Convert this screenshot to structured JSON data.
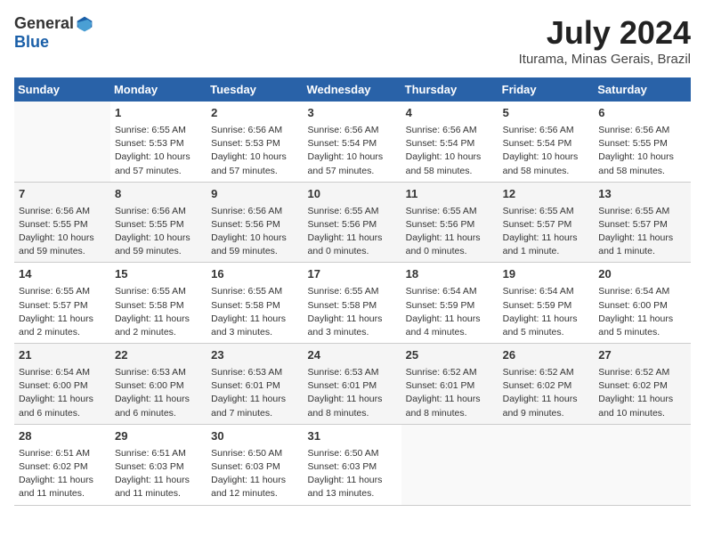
{
  "header": {
    "logo_general": "General",
    "logo_blue": "Blue",
    "month_title": "July 2024",
    "subtitle": "Iturama, Minas Gerais, Brazil"
  },
  "days_of_week": [
    "Sunday",
    "Monday",
    "Tuesday",
    "Wednesday",
    "Thursday",
    "Friday",
    "Saturday"
  ],
  "weeks": [
    [
      {
        "day": "",
        "info": ""
      },
      {
        "day": "1",
        "info": "Sunrise: 6:55 AM\nSunset: 5:53 PM\nDaylight: 10 hours\nand 57 minutes."
      },
      {
        "day": "2",
        "info": "Sunrise: 6:56 AM\nSunset: 5:53 PM\nDaylight: 10 hours\nand 57 minutes."
      },
      {
        "day": "3",
        "info": "Sunrise: 6:56 AM\nSunset: 5:54 PM\nDaylight: 10 hours\nand 57 minutes."
      },
      {
        "day": "4",
        "info": "Sunrise: 6:56 AM\nSunset: 5:54 PM\nDaylight: 10 hours\nand 58 minutes."
      },
      {
        "day": "5",
        "info": "Sunrise: 6:56 AM\nSunset: 5:54 PM\nDaylight: 10 hours\nand 58 minutes."
      },
      {
        "day": "6",
        "info": "Sunrise: 6:56 AM\nSunset: 5:55 PM\nDaylight: 10 hours\nand 58 minutes."
      }
    ],
    [
      {
        "day": "7",
        "info": "Sunrise: 6:56 AM\nSunset: 5:55 PM\nDaylight: 10 hours\nand 59 minutes."
      },
      {
        "day": "8",
        "info": "Sunrise: 6:56 AM\nSunset: 5:55 PM\nDaylight: 10 hours\nand 59 minutes."
      },
      {
        "day": "9",
        "info": "Sunrise: 6:56 AM\nSunset: 5:56 PM\nDaylight: 10 hours\nand 59 minutes."
      },
      {
        "day": "10",
        "info": "Sunrise: 6:55 AM\nSunset: 5:56 PM\nDaylight: 11 hours\nand 0 minutes."
      },
      {
        "day": "11",
        "info": "Sunrise: 6:55 AM\nSunset: 5:56 PM\nDaylight: 11 hours\nand 0 minutes."
      },
      {
        "day": "12",
        "info": "Sunrise: 6:55 AM\nSunset: 5:57 PM\nDaylight: 11 hours\nand 1 minute."
      },
      {
        "day": "13",
        "info": "Sunrise: 6:55 AM\nSunset: 5:57 PM\nDaylight: 11 hours\nand 1 minute."
      }
    ],
    [
      {
        "day": "14",
        "info": "Sunrise: 6:55 AM\nSunset: 5:57 PM\nDaylight: 11 hours\nand 2 minutes."
      },
      {
        "day": "15",
        "info": "Sunrise: 6:55 AM\nSunset: 5:58 PM\nDaylight: 11 hours\nand 2 minutes."
      },
      {
        "day": "16",
        "info": "Sunrise: 6:55 AM\nSunset: 5:58 PM\nDaylight: 11 hours\nand 3 minutes."
      },
      {
        "day": "17",
        "info": "Sunrise: 6:55 AM\nSunset: 5:58 PM\nDaylight: 11 hours\nand 3 minutes."
      },
      {
        "day": "18",
        "info": "Sunrise: 6:54 AM\nSunset: 5:59 PM\nDaylight: 11 hours\nand 4 minutes."
      },
      {
        "day": "19",
        "info": "Sunrise: 6:54 AM\nSunset: 5:59 PM\nDaylight: 11 hours\nand 5 minutes."
      },
      {
        "day": "20",
        "info": "Sunrise: 6:54 AM\nSunset: 6:00 PM\nDaylight: 11 hours\nand 5 minutes."
      }
    ],
    [
      {
        "day": "21",
        "info": "Sunrise: 6:54 AM\nSunset: 6:00 PM\nDaylight: 11 hours\nand 6 minutes."
      },
      {
        "day": "22",
        "info": "Sunrise: 6:53 AM\nSunset: 6:00 PM\nDaylight: 11 hours\nand 6 minutes."
      },
      {
        "day": "23",
        "info": "Sunrise: 6:53 AM\nSunset: 6:01 PM\nDaylight: 11 hours\nand 7 minutes."
      },
      {
        "day": "24",
        "info": "Sunrise: 6:53 AM\nSunset: 6:01 PM\nDaylight: 11 hours\nand 8 minutes."
      },
      {
        "day": "25",
        "info": "Sunrise: 6:52 AM\nSunset: 6:01 PM\nDaylight: 11 hours\nand 8 minutes."
      },
      {
        "day": "26",
        "info": "Sunrise: 6:52 AM\nSunset: 6:02 PM\nDaylight: 11 hours\nand 9 minutes."
      },
      {
        "day": "27",
        "info": "Sunrise: 6:52 AM\nSunset: 6:02 PM\nDaylight: 11 hours\nand 10 minutes."
      }
    ],
    [
      {
        "day": "28",
        "info": "Sunrise: 6:51 AM\nSunset: 6:02 PM\nDaylight: 11 hours\nand 11 minutes."
      },
      {
        "day": "29",
        "info": "Sunrise: 6:51 AM\nSunset: 6:03 PM\nDaylight: 11 hours\nand 11 minutes."
      },
      {
        "day": "30",
        "info": "Sunrise: 6:50 AM\nSunset: 6:03 PM\nDaylight: 11 hours\nand 12 minutes."
      },
      {
        "day": "31",
        "info": "Sunrise: 6:50 AM\nSunset: 6:03 PM\nDaylight: 11 hours\nand 13 minutes."
      },
      {
        "day": "",
        "info": ""
      },
      {
        "day": "",
        "info": ""
      },
      {
        "day": "",
        "info": ""
      }
    ]
  ]
}
